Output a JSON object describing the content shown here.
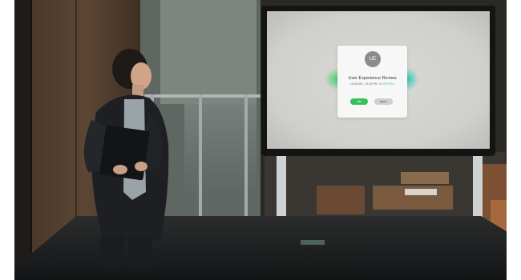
{
  "meeting_card": {
    "avatar_initials": "UE",
    "title": "User Experience Review",
    "time_range": "10:00 AM - 12:30 PM",
    "status": "ACCEPTED"
  },
  "buttons": {
    "join_label": "Join",
    "ignore_label": "Ignore"
  },
  "colors": {
    "accept_green": "#36c258",
    "ignore_gray": "#cfcfcf",
    "card_background": "#f7f7f7",
    "avatar_gray": "#8c8c8c",
    "screen_glow_green": "#36d35c",
    "screen_glow_teal": "#1ec7b0"
  }
}
